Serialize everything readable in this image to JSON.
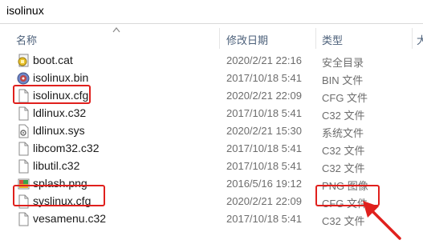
{
  "breadcrumb": "isolinux",
  "columns": {
    "name": "名称",
    "date": "修改日期",
    "type": "类型",
    "size": "大"
  },
  "files": [
    {
      "name": "boot.cat",
      "date": "2020/2/21 22:16",
      "type": "安全目录",
      "icon": "security-catalog-icon"
    },
    {
      "name": "isolinux.bin",
      "date": "2017/10/18 5:41",
      "type": "BIN 文件",
      "icon": "disc-bin-icon"
    },
    {
      "name": "isolinux.cfg",
      "date": "2020/2/21 22:09",
      "type": "CFG 文件",
      "icon": "blank-file-icon"
    },
    {
      "name": "ldlinux.c32",
      "date": "2017/10/18 5:41",
      "type": "C32 文件",
      "icon": "blank-file-icon"
    },
    {
      "name": "ldlinux.sys",
      "date": "2020/2/21 15:30",
      "type": "系统文件",
      "icon": "system-file-icon"
    },
    {
      "name": "libcom32.c32",
      "date": "2017/10/18 5:41",
      "type": "C32 文件",
      "icon": "blank-file-icon"
    },
    {
      "name": "libutil.c32",
      "date": "2017/10/18 5:41",
      "type": "C32 文件",
      "icon": "blank-file-icon"
    },
    {
      "name": "splash.png",
      "date": "2016/5/16 19:12",
      "type": "PNG 图像",
      "icon": "image-file-icon"
    },
    {
      "name": "syslinux.cfg",
      "date": "2020/2/21 22:09",
      "type": "CFG 文件",
      "icon": "blank-file-icon"
    },
    {
      "name": "vesamenu.c32",
      "date": "2017/10/18 5:41",
      "type": "C32 文件",
      "icon": "blank-file-icon"
    }
  ],
  "colors": {
    "highlight": "#e0201d",
    "header_text": "#4c607a",
    "meta_text": "#6d6d6d"
  }
}
